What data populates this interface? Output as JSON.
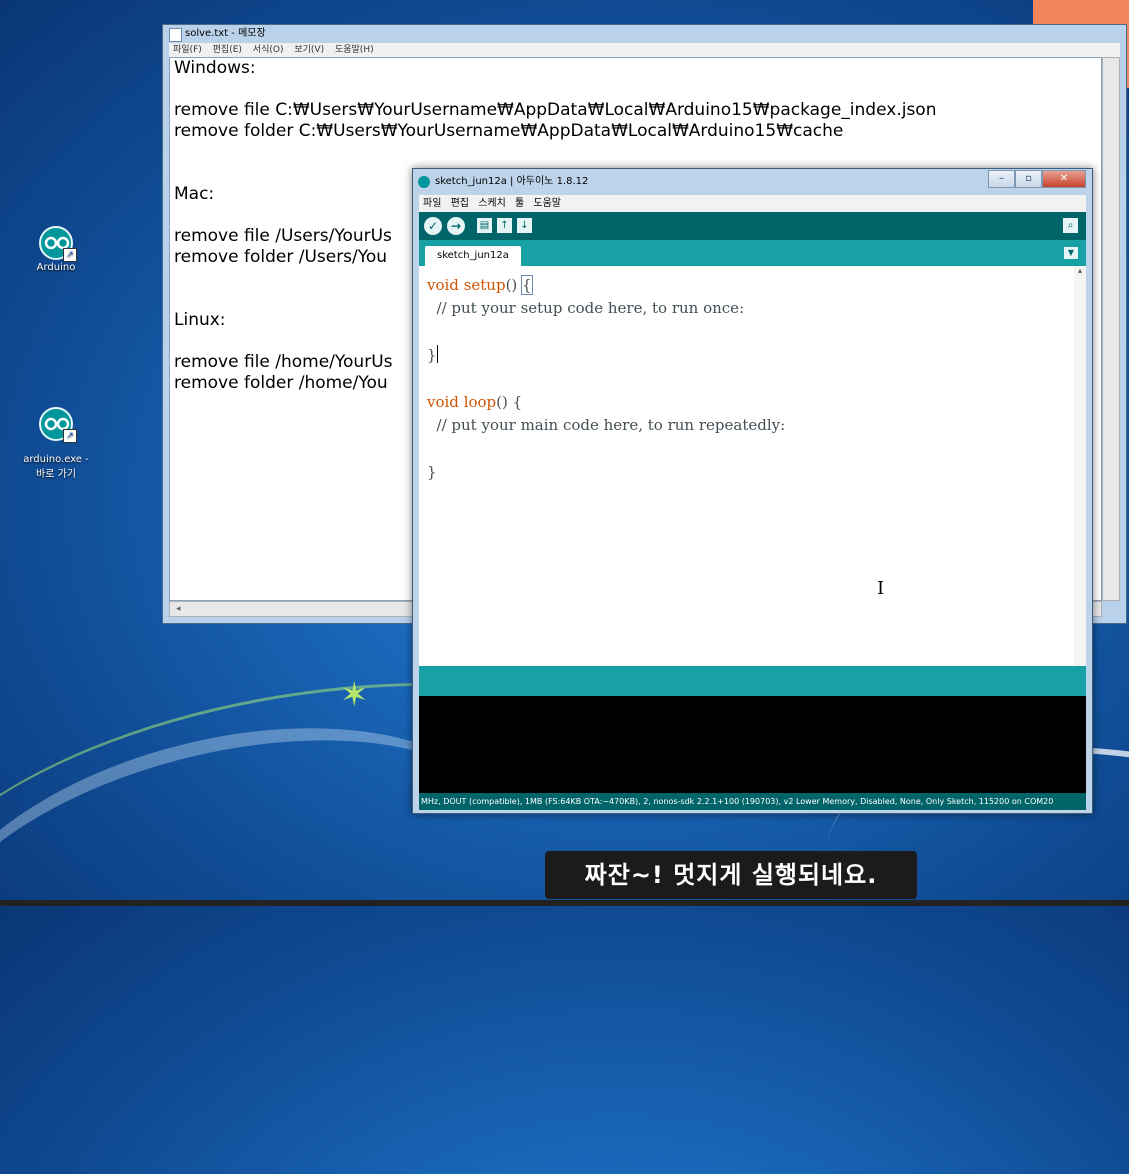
{
  "desktop": {
    "icons": [
      {
        "label": "Arduino"
      },
      {
        "label": "arduino.exe -\n바로 가기"
      }
    ]
  },
  "notepad": {
    "title": "solve.txt - 메모장",
    "menu": [
      "파일(F)",
      "편집(E)",
      "서식(O)",
      "보기(V)",
      "도움말(H)"
    ],
    "content": "Windows:\n\nremove file C:₩Users₩YourUsername₩AppData₩Local₩Arduino15₩package_index.json\nremove folder C:₩Users₩YourUsername₩AppData₩Local₩Arduino15₩cache\n\n\nMac:\n\nremove file /Users/YourUs\nremove folder /Users/You\n\n\nLinux:\n\nremove file /home/YourUs\nremove folder /home/You"
  },
  "arduino": {
    "title": "sketch_jun12a | 아두이노 1.8.12",
    "menu": [
      "파일",
      "편집",
      "스케치",
      "툴",
      "도움말"
    ],
    "tab_label": "sketch_jun12a",
    "code": {
      "line1_kw": "void",
      "line1_fn": "setup",
      "line1_rest": "() ",
      "line1_brace": "{",
      "line2": "  // put your setup code here, to run once:",
      "line4": "}",
      "line6_kw": "void",
      "line6_fn": "loop",
      "line6_rest": "() {",
      "line7": "  // put your main code here, to run repeatedly:",
      "line9": "}"
    },
    "footer": "MHz, DOUT (compatible), 1MB (FS:64KB OTA:~470KB), 2, nonos-sdk 2.2.1+100 (190703), v2 Lower Memory, Disabled, None, Only Sketch, 115200 on COM20"
  },
  "subtitle": "짜잔~!  멋지게 실행되네요."
}
